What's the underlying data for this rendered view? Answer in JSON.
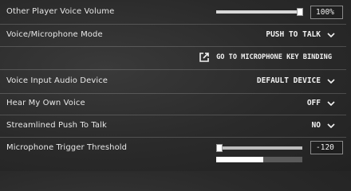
{
  "rows": {
    "other_volume": {
      "label": "Other Player Voice Volume",
      "value_text": "100%",
      "value_fraction": 1.0
    },
    "voice_mode": {
      "label": "Voice/Microphone Mode",
      "selected": "PUSH TO TALK"
    },
    "keybind": {
      "label": "GO TO MICROPHONE KEY BINDING"
    },
    "input_device": {
      "label": "Voice Input Audio Device",
      "selected": "DEFAULT DEVICE"
    },
    "hear_own": {
      "label": "Hear My Own Voice",
      "selected": "OFF"
    },
    "streamlined": {
      "label": "Streamlined Push To Talk",
      "selected": "NO"
    },
    "threshold": {
      "label": "Microphone Trigger Threshold",
      "value_text": "-120",
      "slider_fraction": 0.0,
      "meter_fraction": 0.55
    }
  },
  "icons": {
    "dropdown": "chevron-down-icon",
    "external": "external-link-icon"
  }
}
